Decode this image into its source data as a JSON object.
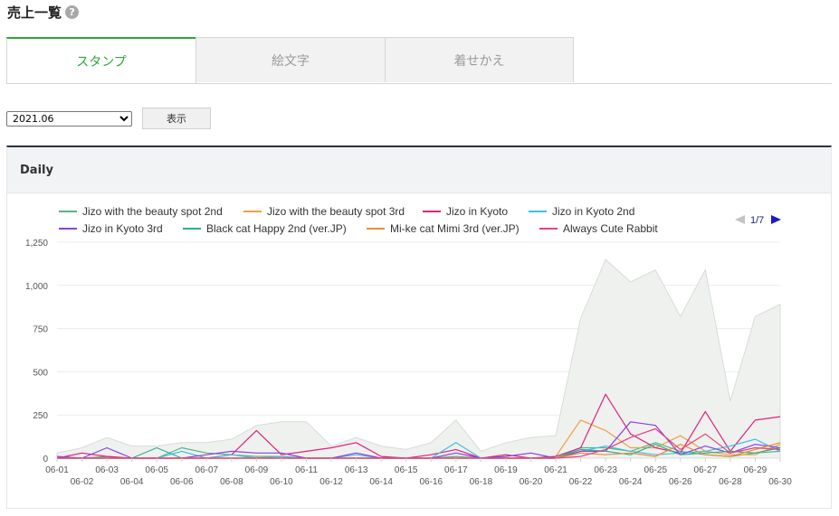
{
  "page": {
    "title": "売上一覧",
    "help_icon": "?"
  },
  "tabs": [
    {
      "label": "スタンプ",
      "active": true
    },
    {
      "label": "絵文字",
      "active": false
    },
    {
      "label": "着せかえ",
      "active": false
    }
  ],
  "filter": {
    "month": "2021.06",
    "show_label": "表示"
  },
  "panel": {
    "title": "Daily"
  },
  "legend_pager": {
    "text": "1/7",
    "prev_icon": "triangle-left-icon",
    "next_icon": "triangle-right-icon"
  },
  "colors": {
    "accent": "#2aa735",
    "header_bar": "#2c3242",
    "total_area": "#eff1ef"
  },
  "chart_data": {
    "type": "line",
    "x": [
      "06-01",
      "06-02",
      "06-03",
      "06-04",
      "06-05",
      "06-06",
      "06-07",
      "06-08",
      "06-09",
      "06-10",
      "06-11",
      "06-12",
      "06-13",
      "06-14",
      "06-15",
      "06-16",
      "06-17",
      "06-18",
      "06-19",
      "06-20",
      "06-21",
      "06-22",
      "06-23",
      "06-24",
      "06-25",
      "06-26",
      "06-27",
      "06-28",
      "06-29",
      "06-30"
    ],
    "ylim": [
      0,
      1250
    ],
    "yticks": [
      0,
      250,
      500,
      750,
      1000,
      1250
    ],
    "ytick_labels": [
      "0",
      "250",
      "500",
      "750",
      "1,000",
      "1,250"
    ],
    "grid": true,
    "legend_position": "top",
    "total": [
      30,
      60,
      120,
      70,
      70,
      90,
      90,
      110,
      190,
      210,
      210,
      70,
      120,
      70,
      50,
      90,
      220,
      40,
      90,
      120,
      130,
      810,
      1150,
      1020,
      1090,
      820,
      1090,
      330,
      820,
      890
    ],
    "series": [
      {
        "name": "Jizo with the beauty spot 2nd",
        "color": "#52b788",
        "values": [
          0,
          0,
          10,
          0,
          0,
          60,
          30,
          20,
          10,
          10,
          0,
          0,
          0,
          0,
          0,
          0,
          10,
          0,
          0,
          0,
          0,
          60,
          60,
          40,
          90,
          40,
          20,
          10,
          30,
          40
        ]
      },
      {
        "name": "Jizo with the beauty spot 3rd",
        "color": "#f0a040",
        "values": [
          0,
          0,
          0,
          0,
          0,
          0,
          0,
          0,
          0,
          0,
          0,
          0,
          0,
          0,
          0,
          0,
          0,
          0,
          0,
          0,
          10,
          220,
          160,
          60,
          60,
          130,
          40,
          20,
          20,
          80
        ]
      },
      {
        "name": "Jizo in Kyoto",
        "color": "#e0217d",
        "values": [
          0,
          30,
          10,
          0,
          0,
          0,
          0,
          20,
          160,
          20,
          40,
          60,
          90,
          10,
          0,
          20,
          50,
          0,
          20,
          0,
          10,
          60,
          370,
          140,
          60,
          30,
          270,
          40,
          220,
          240
        ]
      },
      {
        "name": "Jizo in Kyoto 2nd",
        "color": "#3fbfe0",
        "values": [
          0,
          0,
          0,
          0,
          0,
          40,
          0,
          20,
          0,
          10,
          0,
          0,
          20,
          0,
          0,
          0,
          90,
          0,
          0,
          0,
          0,
          40,
          70,
          40,
          20,
          30,
          40,
          70,
          110,
          40
        ]
      },
      {
        "name": "Jizo in Kyoto 3rd",
        "color": "#8c3fe0",
        "values": [
          10,
          0,
          60,
          0,
          0,
          0,
          20,
          40,
          30,
          30,
          0,
          0,
          30,
          0,
          0,
          0,
          30,
          0,
          10,
          30,
          0,
          40,
          40,
          210,
          190,
          20,
          70,
          30,
          80,
          60
        ]
      },
      {
        "name": "Black cat Happy 2nd (ver.JP)",
        "color": "#2bb08a",
        "values": [
          0,
          0,
          0,
          0,
          60,
          0,
          0,
          0,
          0,
          0,
          0,
          0,
          0,
          0,
          0,
          0,
          0,
          0,
          0,
          0,
          0,
          50,
          40,
          20,
          80,
          20,
          30,
          40,
          30,
          60
        ]
      },
      {
        "name": "Mi-ke cat Mimi 3rd (ver.JP)",
        "color": "#f08a30",
        "values": [
          0,
          0,
          0,
          0,
          0,
          0,
          0,
          0,
          0,
          0,
          0,
          0,
          0,
          0,
          0,
          0,
          0,
          0,
          0,
          0,
          0,
          30,
          20,
          30,
          10,
          80,
          20,
          10,
          50,
          90
        ]
      },
      {
        "name": "Always Cute Rabbit",
        "color": "#e8407a",
        "values": [
          0,
          0,
          0,
          0,
          0,
          0,
          0,
          0,
          0,
          0,
          0,
          0,
          0,
          0,
          0,
          0,
          0,
          0,
          0,
          0,
          0,
          10,
          50,
          120,
          170,
          50,
          140,
          30,
          60,
          50
        ]
      }
    ]
  }
}
